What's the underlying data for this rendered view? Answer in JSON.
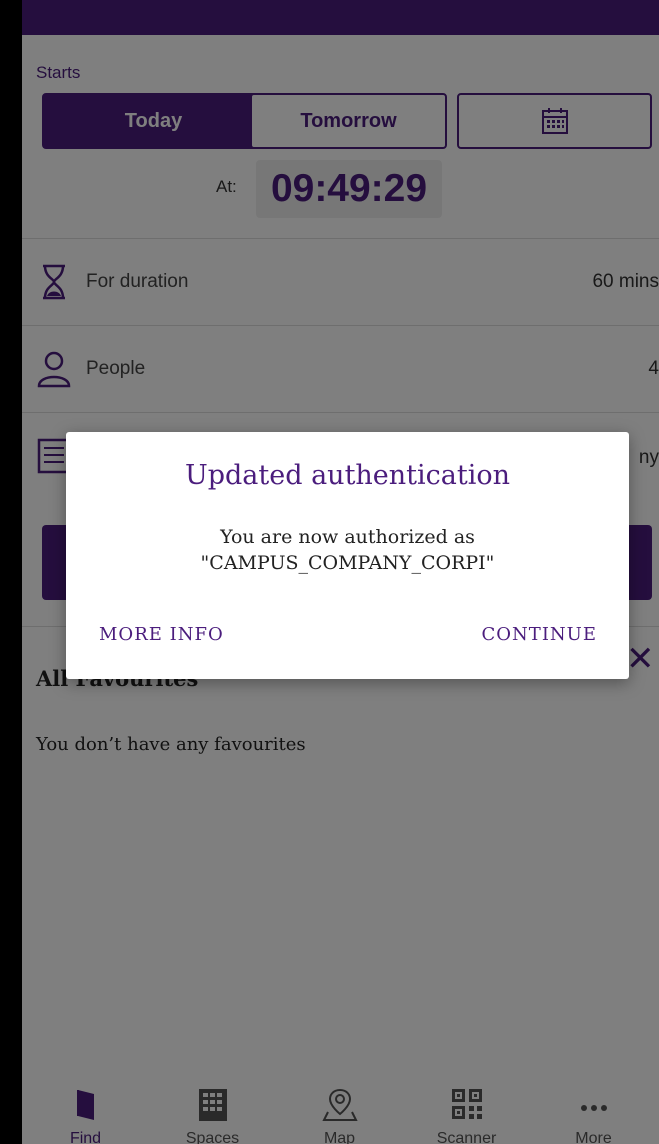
{
  "starts": {
    "label": "Starts",
    "today": "Today",
    "tomorrow": "Tomorrow",
    "calendar_icon": "calendar-icon"
  },
  "time": {
    "at_label": "At:",
    "value": "09:49:29"
  },
  "rows": {
    "duration": {
      "label": "For duration",
      "value": "60 mins",
      "icon": "hourglass-icon"
    },
    "people": {
      "label": "People",
      "value": "4",
      "icon": "person-icon"
    },
    "third": {
      "value": "ny",
      "icon": "list-icon"
    }
  },
  "favourites": {
    "title": "All Favourites",
    "empty": "You don’t have any favourites"
  },
  "tabs": [
    {
      "label": "Find",
      "icon": "door-icon"
    },
    {
      "label": "Spaces",
      "icon": "grid-icon"
    },
    {
      "label": "Map",
      "icon": "map-pin-icon"
    },
    {
      "label": "Scanner",
      "icon": "qr-code-icon"
    },
    {
      "label": "More",
      "icon": "more-dots-icon"
    }
  ],
  "dialog": {
    "title": "Updated authentication",
    "message_line1": "You are now authorized as",
    "message_line2": "\"CAMPUS_COMPANY_CORPI\"",
    "more_info": "MORE INFO",
    "continue": "CONTINUE"
  },
  "colors": {
    "brand": "#4b1d7d",
    "overlay": "rgba(0,0,0,0.5)"
  }
}
